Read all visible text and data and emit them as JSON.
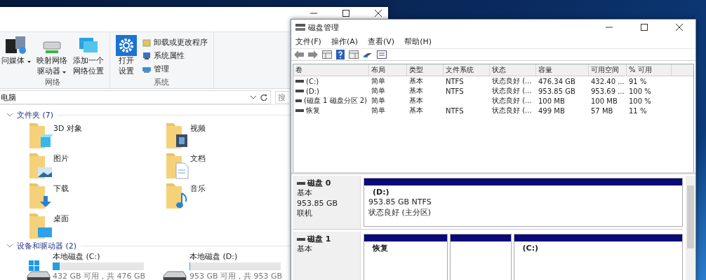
{
  "explorer": {
    "ribbon": {
      "groups": [
        {
          "label": "网络",
          "items": [
            {
              "kind": "media",
              "lines": [
                "问媒体"
              ],
              "dropdown": true
            },
            {
              "kind": "netdrive",
              "lines": [
                "映射网络",
                "驱动器"
              ],
              "dropdown": true
            },
            {
              "kind": "netplace",
              "lines": [
                "添加一个",
                "网络位置"
              ],
              "dropdown": false
            }
          ]
        },
        {
          "label": "系统",
          "items": [
            {
              "kind": "settings",
              "lines": [
                "打开",
                "设置"
              ],
              "dropdown": false
            }
          ],
          "small_items": [
            {
              "kind": "uninstall",
              "label": "卸载或更改程序"
            },
            {
              "kind": "props",
              "label": "系统属性"
            },
            {
              "kind": "manage",
              "label": "管理"
            }
          ]
        }
      ]
    },
    "address": "电脑",
    "search_placeholder": "搜",
    "sections": [
      {
        "title": "文件夹 (7)",
        "expanded": true,
        "items": [
          {
            "name": "3D 对象",
            "kind": "cube"
          },
          {
            "name": "视频",
            "kind": "video"
          },
          {
            "name": "图片",
            "kind": "pictures"
          },
          {
            "name": "文档",
            "kind": "documents"
          },
          {
            "name": "下载",
            "kind": "downloads"
          },
          {
            "name": "音乐",
            "kind": "music"
          },
          {
            "name": "桌面",
            "kind": "desktop"
          }
        ]
      },
      {
        "title": "设备和驱动器 (2)",
        "expanded": true,
        "drives": [
          {
            "name": "本地磁盘 (C:)",
            "kind": "system",
            "level": 0.08,
            "free": "432 GB 可用，共 476 GB"
          },
          {
            "name": "本地磁盘 (D:)",
            "kind": "data",
            "level": 0.01,
            "free": "953 GB 可用，共 953 GB"
          }
        ]
      }
    ]
  },
  "disk_management": {
    "title": "磁盘管理",
    "menu": [
      "文件(F)",
      "操作(A)",
      "查看(V)",
      "帮助(H)"
    ],
    "table": {
      "columns": [
        "卷",
        "布局",
        "类型",
        "文件系统",
        "状态",
        "容量",
        "可用空间",
        "% 可用"
      ],
      "rows": [
        [
          "(C:)",
          "简单",
          "基本",
          "NTFS",
          "状态良好 (...",
          "476.34 GB",
          "432.40 ...",
          "91 %"
        ],
        [
          "(D:)",
          "简单",
          "基本",
          "NTFS",
          "状态良好 (...",
          "953.85 GB",
          "953.69 ...",
          "100 %"
        ],
        [
          "(磁盘 1 磁盘分区 2)",
          "简单",
          "基本",
          "",
          "状态良好 (...",
          "100 MB",
          "100 MB",
          "100 %"
        ],
        [
          "恢复",
          "简单",
          "基本",
          "NTFS",
          "状态良好 (...",
          "499 MB",
          "57 MB",
          "11 %"
        ]
      ]
    },
    "disks": [
      {
        "name": "磁盘 0",
        "lines": [
          "基本",
          "953.85 GB",
          "联机"
        ],
        "partitions": [
          {
            "kind": "primary",
            "name": "(D:)",
            "lines": [
              "953.85 GB NTFS",
              "状态良好 (主分区)"
            ]
          }
        ]
      },
      {
        "name": "磁盘 1",
        "lines": [
          "基本"
        ],
        "partitions": [
          {
            "kind": "primary",
            "name": "恢复"
          },
          {
            "kind": "primary"
          },
          {
            "kind": "primary",
            "name": "(C:)"
          }
        ]
      }
    ]
  }
}
